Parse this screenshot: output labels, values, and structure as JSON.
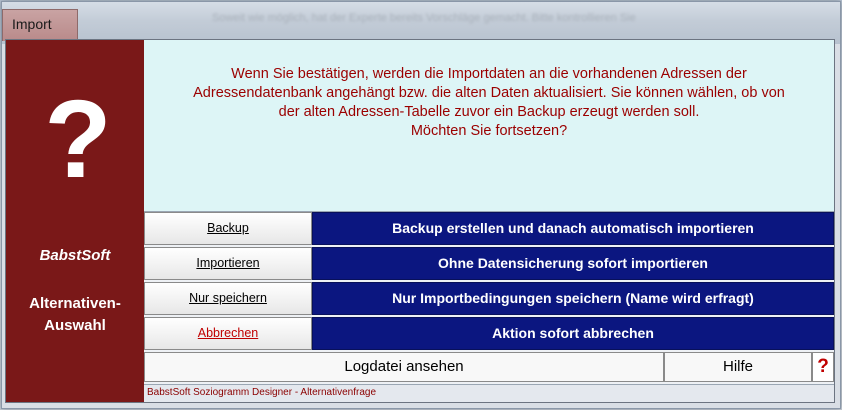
{
  "window": {
    "tab_title": "Import",
    "blurred_title": "Soweit wie möglich, hat der Experte bereits Vorschläge gemacht. Bitte kontrollieren Sie"
  },
  "left_panel": {
    "symbol": "?",
    "brand": "BabstSoft",
    "subtitle_line1": "Alternativen-",
    "subtitle_line2": "Auswahl"
  },
  "message": {
    "line1": "Wenn Sie bestätigen, werden die Importdaten an die vorhandenen Adressen der",
    "line2": "Adressendatenbank angehängt bzw. die alten Daten aktualisiert. Sie können wählen, ob von",
    "line3": "der alten Adressen-Tabelle zuvor ein Backup erzeugt werden soll.",
    "line4": "Möchten Sie fortsetzen?"
  },
  "options": [
    {
      "label": "Backup",
      "description": "Backup erstellen und danach automatisch importieren"
    },
    {
      "label": "Importieren",
      "description": "Ohne Datensicherung sofort importieren"
    },
    {
      "label": "Nur speichern",
      "description": "Nur Importbedingungen speichern (Name wird erfragt)"
    },
    {
      "label": "Abbrechen",
      "description": "Aktion sofort abbrechen"
    }
  ],
  "bottom": {
    "log_button": "Logdatei ansehen",
    "help_button": "Hilfe",
    "help_icon": "?"
  },
  "status": "BabstSoft Soziogramm Designer - Alternativenfrage",
  "colors": {
    "brand_red": "#7a1818",
    "option_blue": "#0b1680",
    "message_bg": "#ddf5f6",
    "message_text": "#9b0000"
  }
}
